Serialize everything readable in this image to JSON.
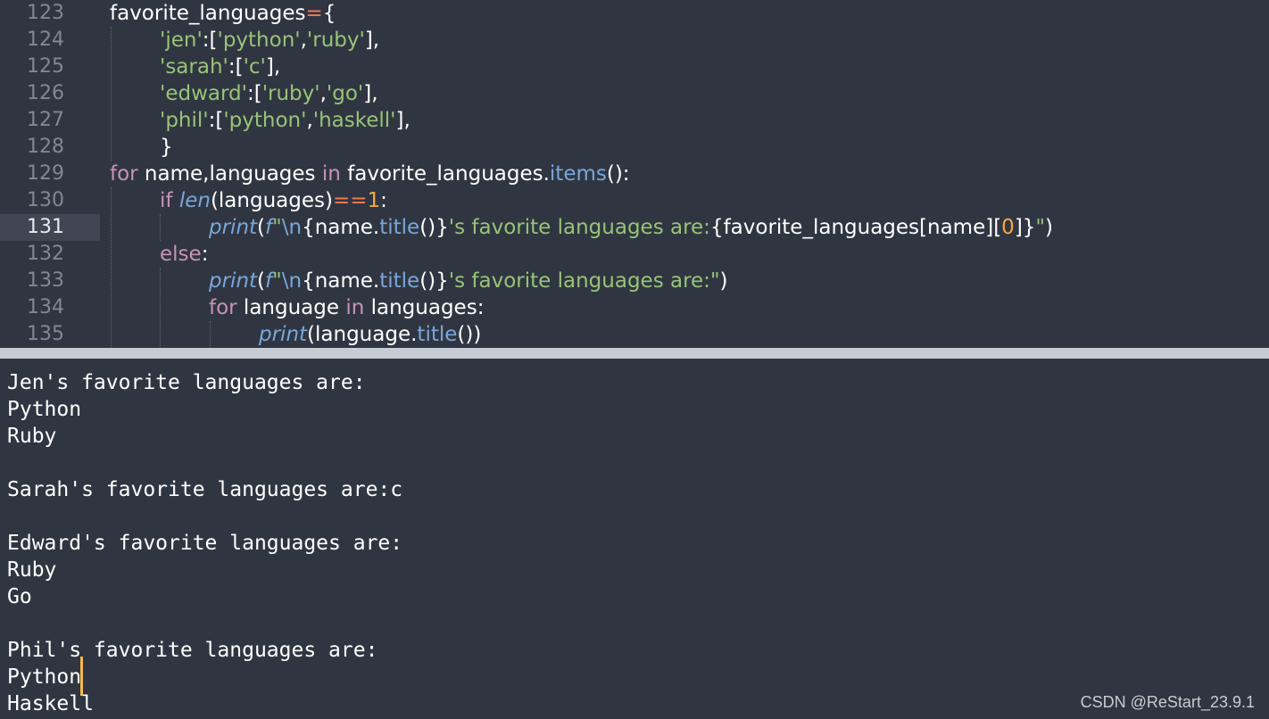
{
  "editor": {
    "line_numbers": [
      "123",
      "124",
      "125",
      "126",
      "127",
      "128",
      "129",
      "130",
      "131",
      "132",
      "133",
      "134",
      "135"
    ],
    "active_line": "131"
  },
  "code": {
    "l123": {
      "a": "favorite_languages",
      "b": "=",
      "c": "{"
    },
    "l124": {
      "s1": "'jen'",
      "p1": ":[",
      "s2": "'python'",
      "p2": ",",
      "s3": "'ruby'",
      "p3": "],"
    },
    "l125": {
      "s1": "'sarah'",
      "p1": ":[",
      "s2": "'c'",
      "p2": "],"
    },
    "l126": {
      "s1": "'edward'",
      "p1": ":[",
      "s2": "'ruby'",
      "p2": ",",
      "s3": "'go'",
      "p3": "],"
    },
    "l127": {
      "s1": "'phil'",
      "p1": ":[",
      "s2": "'python'",
      "p2": ",",
      "s3": "'haskell'",
      "p3": "],"
    },
    "l128": {
      "a": "}"
    },
    "l129": {
      "k1": "for",
      "a": " name,languages ",
      "k2": "in",
      "b": " favorite_languages.",
      "m": "items",
      "c": "():"
    },
    "l130": {
      "k1": "if",
      "sp": " ",
      "bi": "len",
      "a": "(languages)",
      "op": "==",
      "n": "1",
      "c": ":"
    },
    "l131": {
      "bi": "print",
      "p1": "(",
      "f": "f",
      "q1": "\"",
      "esc": "\\n",
      "a": "{name.",
      "m": "title",
      "b": "()}",
      "s": "'s favorite languages are:",
      "c": "{favorite_languages[name][",
      "n": "0",
      "d": "]}",
      "q2": "\"",
      "e": ")"
    },
    "l132": {
      "k": "else",
      "a": ":"
    },
    "l133": {
      "bi": "print",
      "p1": "(",
      "f": "f",
      "q1": "\"",
      "esc": "\\n",
      "a": "{name.",
      "m": "title",
      "b": "()}",
      "s": "'s favorite languages are:",
      "q2": "\"",
      "e": ")"
    },
    "l134": {
      "k1": "for",
      "a": " language ",
      "k2": "in",
      "b": " languages:"
    },
    "l135": {
      "bi": "print",
      "a": "(language.",
      "m": "title",
      "b": "())"
    }
  },
  "console": {
    "lines": [
      "Jen's favorite languages are:",
      "Python",
      "Ruby",
      "",
      "Sarah's favorite languages are:c",
      "",
      "Edward's favorite languages are:",
      "Ruby",
      "Go",
      "",
      "Phil's favorite languages are:",
      "Python",
      "Haskell"
    ]
  },
  "watermark": "CSDN @ReStart_23.9.1",
  "colors": {
    "background": "#303641",
    "keyword": "#c792b8",
    "string": "#98c379",
    "builtin": "#7aa6da",
    "operator": "#f07c55",
    "number": "#f5a742",
    "cursor": "#f6b84b"
  }
}
